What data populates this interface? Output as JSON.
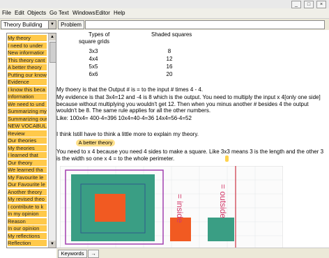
{
  "window_controls": [
    "_",
    "□",
    "×"
  ],
  "menu": [
    "File",
    "Edit",
    "Objects",
    "Go",
    "Text",
    "Windows",
    "Editor",
    "Help"
  ],
  "toolbar": {
    "view_selected": "Theory Building",
    "problem_button": "Problem",
    "problem_field": ""
  },
  "sidebar": {
    "items": [
      "My theory",
      "I need to under",
      "New informatior",
      "This theory cant",
      "A better theory",
      "Putting our know",
      "Evidence",
      "I know this beca",
      "Information",
      "We need to und",
      "Summarizing my",
      "Summarizing our",
      "NEW VOCABULA",
      "Review",
      "Our theories",
      "My theories",
      "I learned that",
      "Our theory",
      "We learned tha",
      "My Favourite le",
      "Our Favourite le",
      "Another theory",
      "My revised theo",
      "I contribute to k",
      "In my opinion",
      "Reason",
      "In our opinion",
      "My reflections",
      "Reflection"
    ]
  },
  "table": {
    "col1": "Types of",
    "col1b": "square grids",
    "col2": "Shaded squares",
    "rows": [
      [
        "3x3",
        "8"
      ],
      [
        "4x4",
        "12"
      ],
      [
        "5x5",
        "16"
      ],
      [
        "6x6",
        "20"
      ]
    ]
  },
  "note": {
    "p1": "My thoery is that the Output # is = to the input # times 4 - 4.",
    "p2": "My evidence is that 3x4=12 and -4 is 8 which is the output. You need to multiply the input x 4[only one side] because without multiplying you wouldn't get 12. Then when you minus another # besides 4 the output wouldn't be 8. The same rule applies for all the other numbers.",
    "p3": "Like: 100x4= 400-4=396     10x4=40-4=36     14x4=56-4=52",
    "p4": "I think Istill have to think a little more to explain my theory.",
    "chip": "A better theory",
    "p5": "You need to x 4 because you need 4 sides to make a square. Like 3x3 means 3 is the length and the other 3 is the width so one x 4 = to the whole perimeter."
  },
  "drawing": {
    "label_inside": "= inside",
    "label_outside": "= outside"
  },
  "bottom": {
    "keywords": "Keywords",
    "arrow": "→"
  }
}
